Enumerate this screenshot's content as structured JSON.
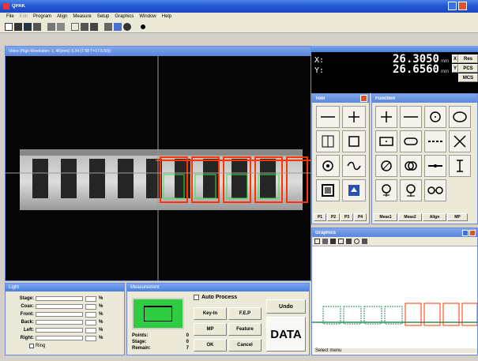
{
  "app": {
    "title": "QPAK",
    "menu": [
      "File",
      "Edit",
      "Program",
      "Align",
      "Measure",
      "Setup",
      "Graphics",
      "Window",
      "Help"
    ]
  },
  "video": {
    "title": "Video (High Resolution: 1, 4K[mm]: 5.34 (7.58 T=17.6.50))"
  },
  "dro": {
    "x_label": "X:",
    "x_value": "26.3050",
    "x_unit": "mm",
    "y_label": "Y:",
    "y_value": "26.6560",
    "y_unit": "mm",
    "buttons": [
      "Res",
      "PCS",
      "MCS"
    ],
    "side": [
      "X",
      "Y"
    ]
  },
  "tool_panel": {
    "title": "Tool",
    "tabs": [
      "P1",
      "P2",
      "P3",
      "P4"
    ]
  },
  "function_panel": {
    "title": "Function",
    "tabs": [
      "Meas1",
      "Meas2",
      "Align",
      "MP"
    ]
  },
  "graphics": {
    "title": "Graphics",
    "status": "Select menu"
  },
  "light": {
    "title": "Light",
    "rows": [
      "Stage:",
      "Coax:",
      "Front:",
      "Back:",
      "Left:",
      "Right:"
    ],
    "unit": "%",
    "ring_label": "Ring"
  },
  "measurement": {
    "title": "Measurement",
    "auto_process": "Auto Process",
    "undo": "Undo",
    "key_in": "Key-In",
    "fep": "F.E.P",
    "mp": "MP",
    "feature": "Feature",
    "ok": "OK",
    "cancel": "Cancel",
    "data": "DATA",
    "stats": [
      {
        "label": "Points:",
        "value": "0"
      },
      {
        "label": "Stage:",
        "value": "0"
      },
      {
        "label": "Remain:",
        "value": "7"
      }
    ]
  },
  "colors": {
    "xp_title": "#2458d6",
    "dro_bg": "#000000",
    "dro_text": "#ffffff",
    "part_highlight": "#ff3300",
    "video_bg": "#050505"
  }
}
